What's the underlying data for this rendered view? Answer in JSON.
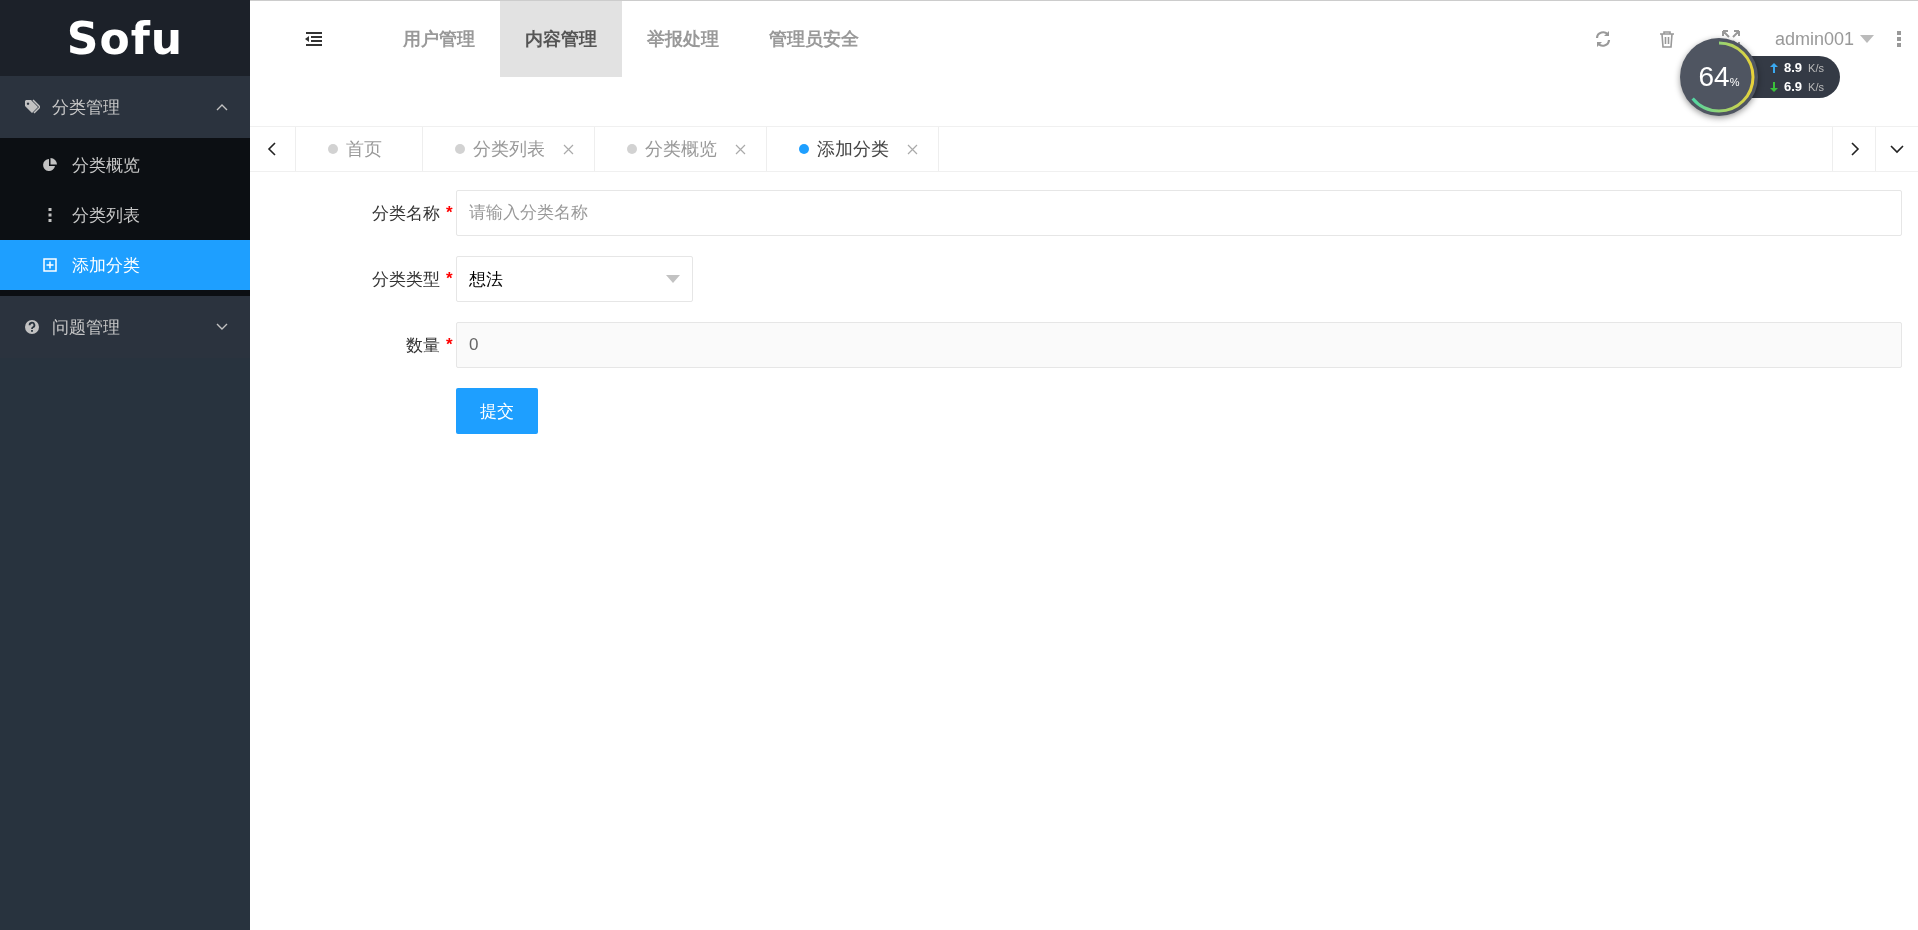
{
  "sidebar": {
    "logo": "Sofu",
    "groups": [
      {
        "label": "分类管理",
        "kind": "tag",
        "expanded": true,
        "children": [
          {
            "label": "分类概览",
            "kind": "pie",
            "selected": false
          },
          {
            "label": "分类列表",
            "kind": "dots",
            "selected": false
          },
          {
            "label": "添加分类",
            "kind": "plus-square",
            "selected": true
          }
        ]
      },
      {
        "label": "问题管理",
        "kind": "question",
        "expanded": false
      }
    ]
  },
  "header": {
    "nav": [
      {
        "label": "用户管理",
        "selected": false
      },
      {
        "label": "内容管理",
        "selected": true
      },
      {
        "label": "举报处理",
        "selected": false
      },
      {
        "label": "管理员安全",
        "selected": false
      }
    ],
    "user": "admin001"
  },
  "network_widget": {
    "percent": "64",
    "unit": "%",
    "upload": "8.9",
    "upload_unit": "K/s",
    "download": "6.9",
    "download_unit": "K/s"
  },
  "page_tabs": [
    {
      "label": "首页",
      "selected": false,
      "closable": false
    },
    {
      "label": "分类列表",
      "selected": false,
      "closable": true
    },
    {
      "label": "分类概览",
      "selected": false,
      "closable": true
    },
    {
      "label": "添加分类",
      "selected": true,
      "closable": true
    }
  ],
  "form": {
    "fields": [
      {
        "kind": "text",
        "label": "分类名称",
        "mark": "*",
        "placeholder": "请输入分类名称"
      },
      {
        "kind": "select",
        "label": "分类类型",
        "mark": "*",
        "value": "想法"
      },
      {
        "kind": "text",
        "label": "数量",
        "mark": "*",
        "value": "0",
        "disabled": true
      }
    ],
    "submit": "提交"
  }
}
